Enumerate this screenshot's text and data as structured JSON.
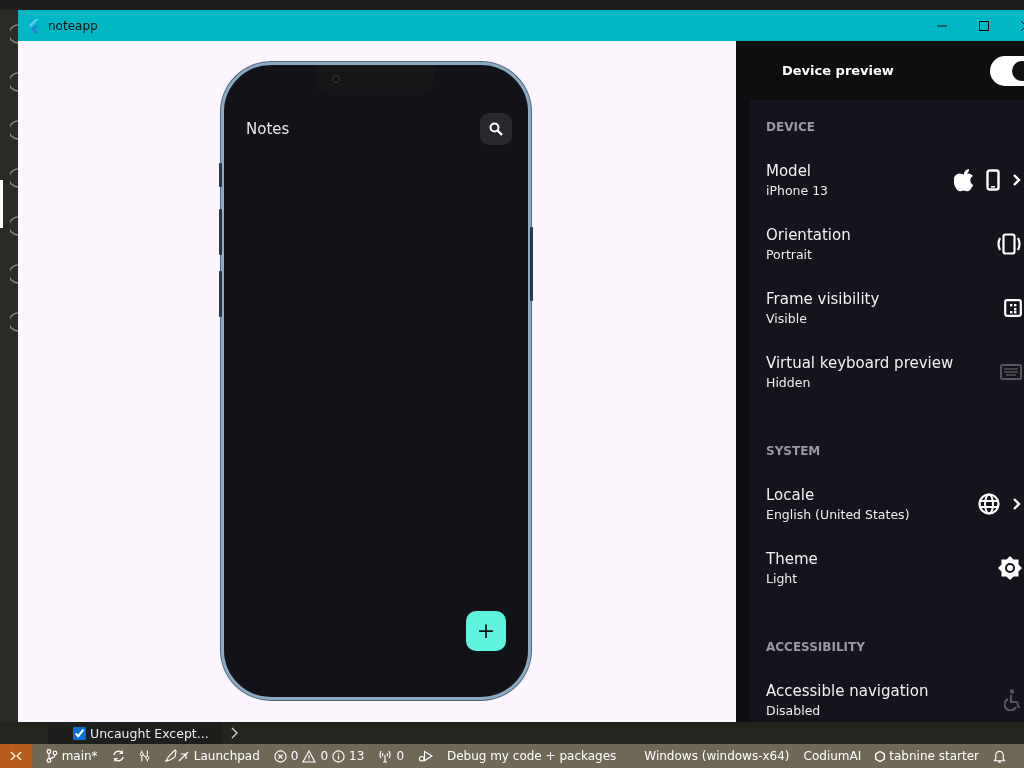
{
  "window": {
    "title": "noteapp"
  },
  "app": {
    "title": "Notes",
    "fab_label": "+"
  },
  "device_preview": {
    "title": "Device preview",
    "enabled": true,
    "sections": [
      {
        "title": "DEVICE",
        "items": [
          {
            "kind": "model",
            "label": "Model",
            "value": "iPhone 13"
          },
          {
            "kind": "orientation",
            "label": "Orientation",
            "value": "Portrait"
          },
          {
            "kind": "frame",
            "label": "Frame visibility",
            "value": "Visible"
          },
          {
            "kind": "keyboard",
            "label": "Virtual keyboard preview",
            "value": "Hidden"
          }
        ]
      },
      {
        "title": "SYSTEM",
        "items": [
          {
            "kind": "locale",
            "label": "Locale",
            "value": "English (United States)"
          },
          {
            "kind": "theme",
            "label": "Theme",
            "value": "Light"
          }
        ]
      },
      {
        "title": "ACCESSIBILITY",
        "items": [
          {
            "kind": "accessibility",
            "label": "Accessible navigation",
            "value": "Disabled"
          }
        ]
      }
    ]
  },
  "breakpoints": {
    "label": "Uncaught Except...",
    "checked": true
  },
  "status_bar": [
    {
      "kind": "branch",
      "text": "main*"
    },
    {
      "kind": "graph"
    },
    {
      "kind": "launchpad",
      "text": "Launchpad"
    },
    {
      "kind": "problems",
      "errors": "0",
      "warnings": "0",
      "infos": "13"
    },
    {
      "kind": "ports",
      "text": "0"
    },
    {
      "kind": "debug",
      "text": "Debug my code + packages"
    },
    {
      "kind": "spacer"
    },
    {
      "kind": "plain",
      "text": "Windows (windows-x64)"
    },
    {
      "kind": "plain",
      "text": "CodiumAI"
    },
    {
      "kind": "tabnine",
      "text": "tabnine starter"
    },
    {
      "kind": "bell"
    }
  ]
}
